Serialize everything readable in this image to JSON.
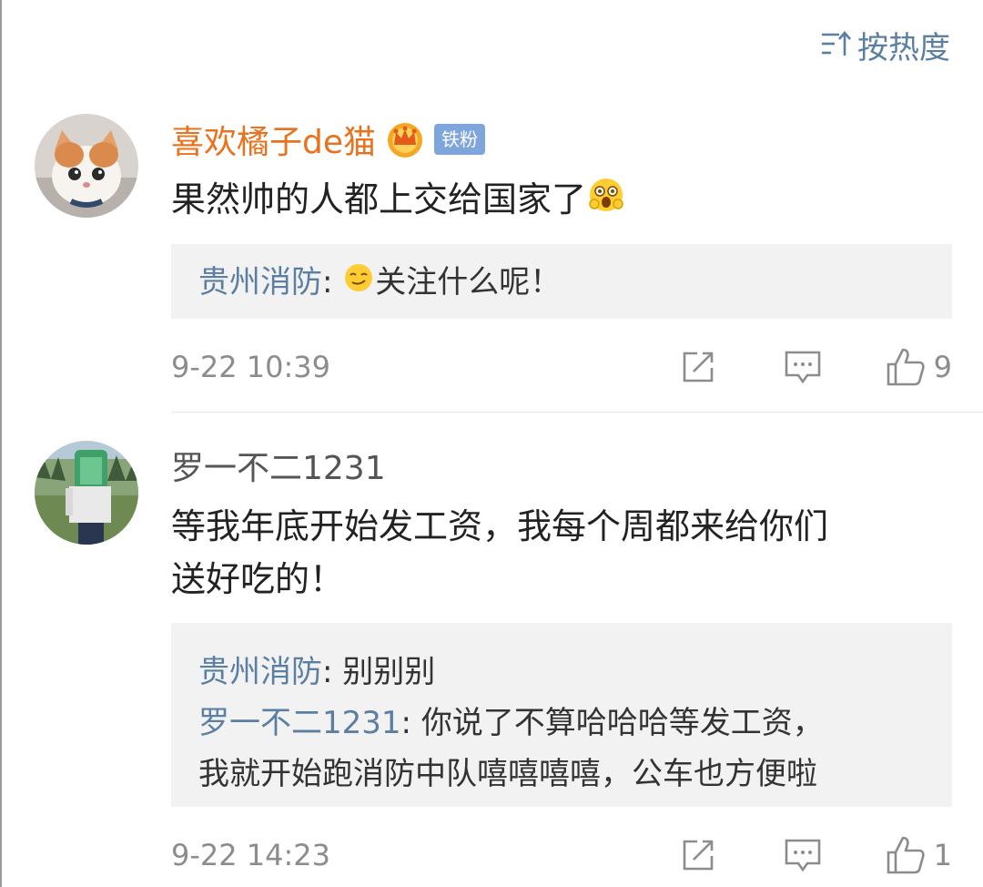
{
  "sort": {
    "label": "按热度",
    "icon": "sort-icon"
  },
  "comments": [
    {
      "username": "喜欢橘子de猫",
      "badges": {
        "crown": "vip-crown-icon",
        "fan_label": "铁粉"
      },
      "text": "果然帅的人都上交给国家了",
      "text_emoji": "surprised-emoji",
      "replies": [
        {
          "user": "贵州消防",
          "sep": ":",
          "emoji": "smirk-emoji",
          "text": "关注什么呢！"
        }
      ],
      "time": "9-22 10:39",
      "likes": "9"
    },
    {
      "username": "罗一不二1231",
      "text_line1": "等我年底开始发工资，我每个周都来给你们",
      "text_line2": "送好吃的！",
      "replies": [
        {
          "user": "贵州消防",
          "sep": ":",
          "text": "别别别"
        },
        {
          "user": "罗一不二1231",
          "sep": ":",
          "text": "你说了不算哈哈哈等发工资，",
          "text2": "我就开始跑消防中队嘻嘻嘻嘻，公车也方便啦"
        }
      ],
      "time": "9-22 14:23",
      "likes": "1"
    }
  ],
  "colors": {
    "link_blue": "#5b7fa3",
    "vip_orange": "#e8721d",
    "meta_gray": "#8c8c8c",
    "reply_bg": "#f2f2f2"
  }
}
